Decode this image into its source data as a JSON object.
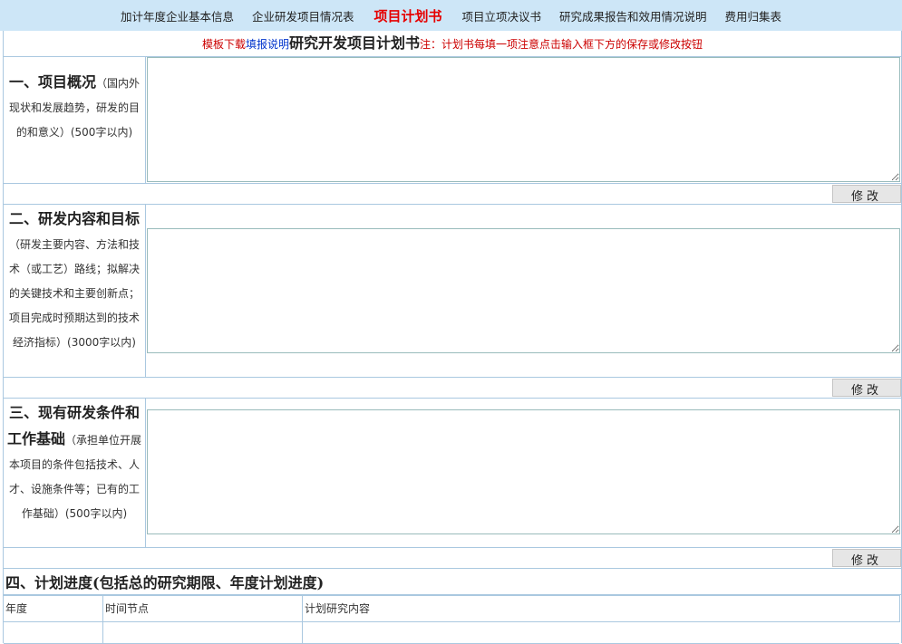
{
  "nav": {
    "items": [
      {
        "label": "加计年度企业基本信息",
        "active": false
      },
      {
        "label": "企业研发项目情况表",
        "active": false
      },
      {
        "label": "项目计划书",
        "active": true
      },
      {
        "label": "项目立项决议书",
        "active": false
      },
      {
        "label": "研究成果报告和效用情况说明",
        "active": false
      },
      {
        "label": "费用归集表",
        "active": false
      }
    ]
  },
  "notice": {
    "download_prefix": "模板下载",
    "download_link": "填报说明",
    "title": "研究开发项目计划书",
    "note": "注：计划书每填一项注意点击输入框下方的保存或修改按钮"
  },
  "sections": [
    {
      "heading": "一、项目概况",
      "desc": "（国内外现状和发展趋势，研发的目的和意义）(500字以内)",
      "button": "修改"
    },
    {
      "heading": "二、研发内容和目标",
      "desc": "（研发主要内容、方法和技术（或工艺）路线；拟解决的关键技术和主要创新点；项目完成时预期达到的技术经济指标）(3000字以内)",
      "button": "修改"
    },
    {
      "heading": "三、现有研发条件和工作基础",
      "desc": "（承担单位开展本项目的条件包括技术、人才、设施条件等；已有的工作基础）(500字以内)",
      "button": "修改"
    }
  ],
  "schedule": {
    "heading": "四、计划进度(包括总的研究期限、年度计划进度)",
    "columns": [
      "年度",
      "时间节点",
      "计划研究内容"
    ]
  },
  "colors": {
    "nav_bg": "#cde6f7",
    "active": "#e60000",
    "border": "#aac8e0",
    "note": "#cc0000"
  }
}
